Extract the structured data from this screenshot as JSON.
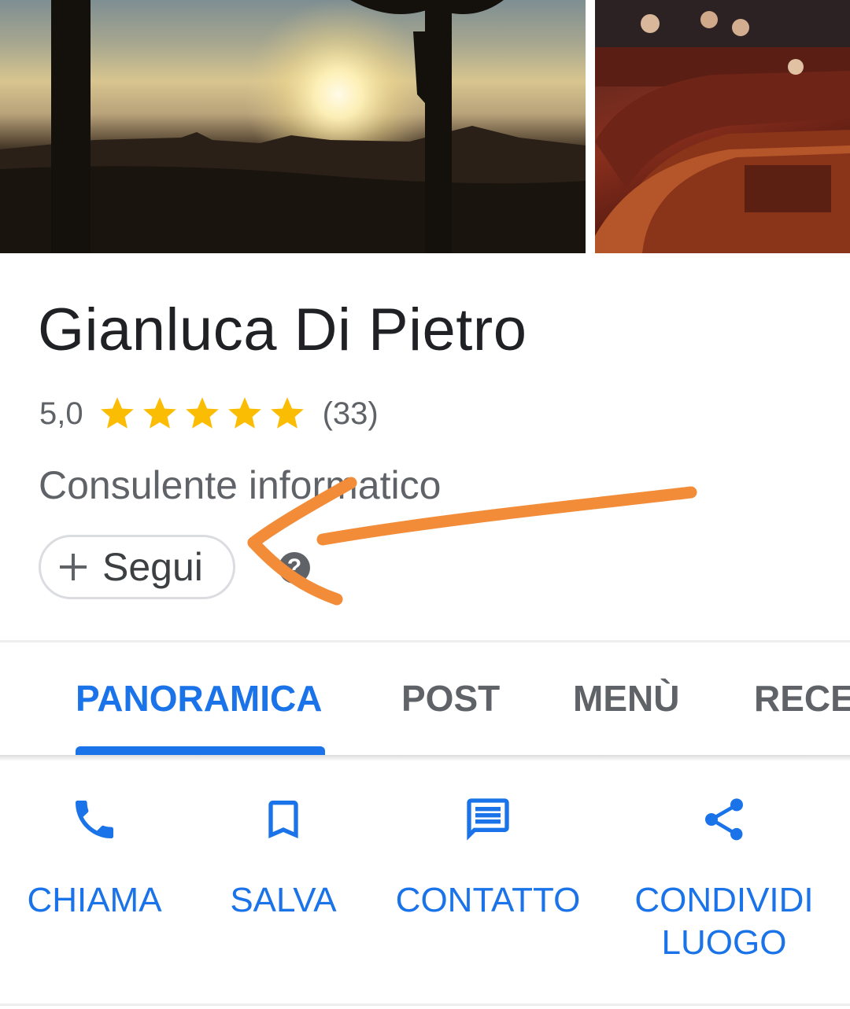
{
  "place": {
    "name": "Gianluca Di Pietro",
    "rating": "5,0",
    "stars": 5,
    "review_count": "(33)",
    "category": "Consulente informatico"
  },
  "follow_button": {
    "label": "Segui",
    "icon": "plus-icon"
  },
  "help_icon": "?",
  "tabs": [
    {
      "label": "PANORAMICA",
      "active": true
    },
    {
      "label": "POST",
      "active": false
    },
    {
      "label": "MENÙ",
      "active": false
    },
    {
      "label": "RECENSIONI",
      "active": false
    }
  ],
  "actions": [
    {
      "label": "CHIAMA",
      "icon": "phone-icon"
    },
    {
      "label": "SALVA",
      "icon": "bookmark-icon"
    },
    {
      "label": "CONTATTO",
      "icon": "message-icon"
    },
    {
      "label": "CONDIVIDI LUOGO",
      "icon": "share-icon"
    }
  ],
  "colors": {
    "accent": "#1a73e8",
    "star": "#fbbc04",
    "text_primary": "#202124",
    "text_secondary": "#5f6368",
    "annotation_arrow": "#f28c38"
  }
}
